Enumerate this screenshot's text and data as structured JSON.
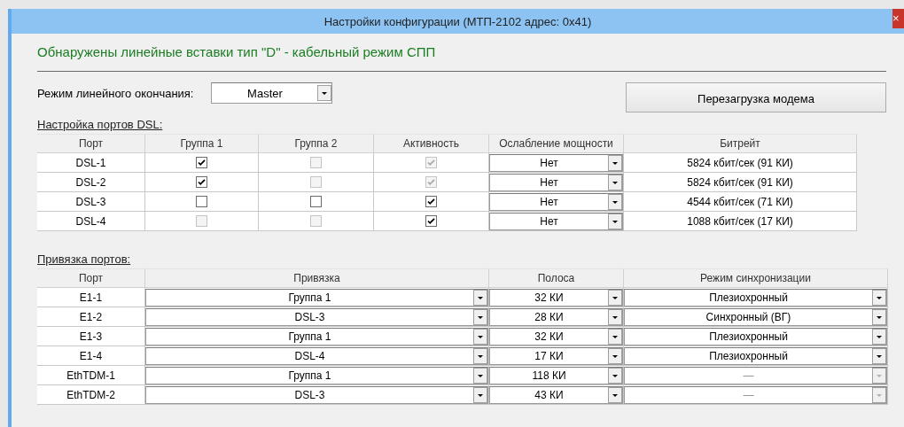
{
  "window": {
    "title": "Настройки конфигурации (МТП-2102 адрес: 0x41)",
    "close": "×"
  },
  "notice": "Обнаружены линейные вставки тип \"D\" - кабельный режим СПП",
  "line_mode": {
    "label": "Режим линейного окончания:",
    "value": "Master"
  },
  "reload_button": "Перезагрузка модема",
  "dsl_section": {
    "title": "Настройка портов DSL:",
    "columns": [
      "Порт",
      "Группа 1",
      "Группа 2",
      "Активность",
      "Ослабление мощности",
      "Битрейт"
    ],
    "rows": [
      {
        "port": "DSL-1",
        "group1": {
          "checked": true,
          "disabled": false
        },
        "group2": {
          "checked": false,
          "disabled": true
        },
        "active": {
          "checked": true,
          "disabled": true
        },
        "attenuation": "Нет",
        "bitrate": "5824 кбит/сек (91 КИ)"
      },
      {
        "port": "DSL-2",
        "group1": {
          "checked": true,
          "disabled": false
        },
        "group2": {
          "checked": false,
          "disabled": true
        },
        "active": {
          "checked": true,
          "disabled": true
        },
        "attenuation": "Нет",
        "bitrate": "5824 кбит/сек (91 КИ)"
      },
      {
        "port": "DSL-3",
        "group1": {
          "checked": false,
          "disabled": false
        },
        "group2": {
          "checked": false,
          "disabled": false
        },
        "active": {
          "checked": true,
          "disabled": false
        },
        "attenuation": "Нет",
        "bitrate": "4544 кбит/сек (71 КИ)"
      },
      {
        "port": "DSL-4",
        "group1": {
          "checked": false,
          "disabled": true
        },
        "group2": {
          "checked": false,
          "disabled": true
        },
        "active": {
          "checked": true,
          "disabled": false
        },
        "attenuation": "Нет",
        "bitrate": "1088 кбит/сек (17 КИ)"
      }
    ]
  },
  "binding_section": {
    "title": "Привязка портов:",
    "columns": [
      "Порт",
      "Привязка",
      "Полоса",
      "Режим синхронизации"
    ],
    "rows": [
      {
        "port": "E1-1",
        "binding": "Группа 1",
        "band": "32 КИ",
        "sync": {
          "value": "Плезиохронный",
          "disabled": false
        }
      },
      {
        "port": "E1-2",
        "binding": "DSL-3",
        "band": "28 КИ",
        "sync": {
          "value": "Синхронный (ВГ)",
          "disabled": false
        }
      },
      {
        "port": "E1-3",
        "binding": "Группа 1",
        "band": "32 КИ",
        "sync": {
          "value": "Плезиохронный",
          "disabled": false
        }
      },
      {
        "port": "E1-4",
        "binding": "DSL-4",
        "band": "17 КИ",
        "sync": {
          "value": "Плезиохронный",
          "disabled": false
        }
      },
      {
        "port": "EthTDM-1",
        "binding": "Группа 1",
        "band": "118 КИ",
        "sync": {
          "value": "—",
          "disabled": true
        }
      },
      {
        "port": "EthTDM-2",
        "binding": "DSL-3",
        "band": "43 КИ",
        "sync": {
          "value": "—",
          "disabled": true
        }
      }
    ]
  }
}
